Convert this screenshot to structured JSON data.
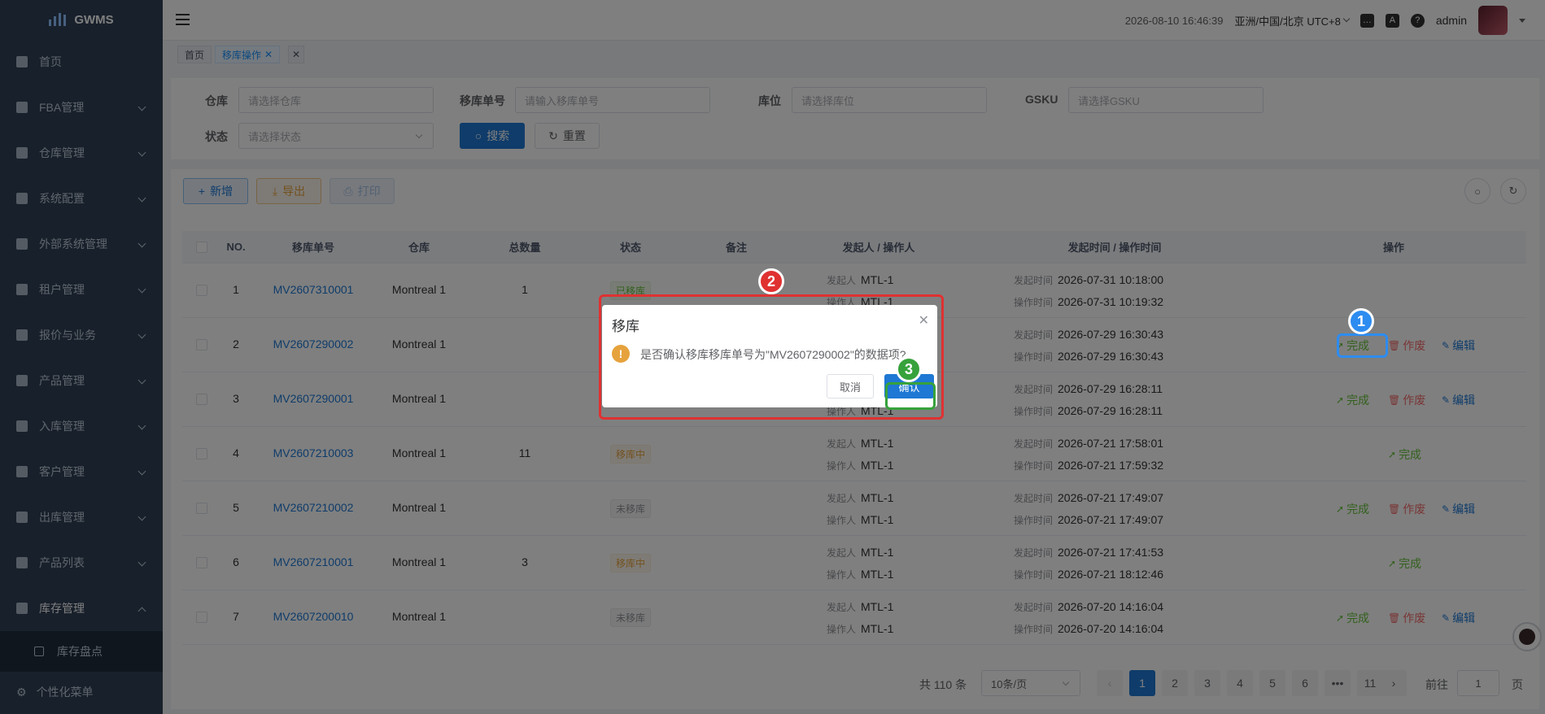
{
  "app": {
    "name": "GWMS"
  },
  "sidebar": {
    "items": [
      {
        "label": "首页",
        "icon": "dashboard-icon",
        "has_children": false
      },
      {
        "label": "FBA管理",
        "icon": "fba-icon",
        "has_children": true
      },
      {
        "label": "仓库管理",
        "icon": "warehouse-icon",
        "has_children": true
      },
      {
        "label": "系统配置",
        "icon": "config-icon",
        "has_children": true
      },
      {
        "label": "外部系统管理",
        "icon": "grid-icon",
        "has_children": true
      },
      {
        "label": "租户管理",
        "icon": "bar-chart-icon",
        "has_children": true
      },
      {
        "label": "报价与业务",
        "icon": "quote-icon",
        "has_children": true
      },
      {
        "label": "产品管理",
        "icon": "cart-icon",
        "has_children": true
      },
      {
        "label": "入库管理",
        "icon": "home-icon",
        "has_children": true
      },
      {
        "label": "客户管理",
        "icon": "user-icon",
        "has_children": true
      },
      {
        "label": "出库管理",
        "icon": "grid-icon",
        "has_children": true
      },
      {
        "label": "产品列表",
        "icon": "book-icon",
        "has_children": true
      },
      {
        "label": "库存管理",
        "icon": "table-icon",
        "has_children": true,
        "open": true
      }
    ],
    "sub_item": "库存盘点",
    "bottom_item": "个性化菜单"
  },
  "header": {
    "datetime": "2026-08-10 16:46:39",
    "timezone": "亚洲/中国/北京 UTC+8",
    "user": "admin"
  },
  "tags": {
    "home": "首页",
    "current": "移库操作"
  },
  "search": {
    "warehouse_label": "仓库",
    "warehouse_placeholder": "请选择仓库",
    "move_no_label": "移库单号",
    "move_no_placeholder": "请输入移库单号",
    "location_label": "库位",
    "location_placeholder": "请选择库位",
    "gsku_label": "GSKU",
    "gsku_placeholder": "请选择GSKU",
    "status_label": "状态",
    "status_placeholder": "请选择状态",
    "search_button": "搜索",
    "reset_button": "重置"
  },
  "toolbar": {
    "add": "新增",
    "export": "导出",
    "print": "打印"
  },
  "table": {
    "headers": [
      "NO.",
      "移库单号",
      "仓库",
      "总数量",
      "状态",
      "备注",
      "发起人 / 操作人",
      "发起时间 / 操作时间",
      "操作"
    ],
    "initiator_key": "发起人",
    "operator_key": "操作人",
    "start_time_key": "发起时间",
    "op_time_key": "操作时间",
    "actions": {
      "complete": "完成",
      "void": "作废",
      "edit": "编辑"
    },
    "rows": [
      {
        "no": "1",
        "move_no": "MV2607310001",
        "warehouse": "Montreal 1",
        "qty": "1",
        "status": "已移库",
        "status_type": "done",
        "initiator": "MTL-1",
        "operator": "MTL-1",
        "start_time": "2026-07-31 10:18:00",
        "op_time": "2026-07-31 10:19:32",
        "show_complete": false,
        "show_void": false,
        "show_edit": false
      },
      {
        "no": "2",
        "move_no": "MV2607290002",
        "warehouse": "Montreal 1",
        "qty": "",
        "status": "",
        "status_type": "",
        "initiator": "",
        "operator": "",
        "start_time": "2026-07-29 16:30:43",
        "op_time": "2026-07-29 16:30:43",
        "show_complete": true,
        "show_void": true,
        "show_edit": true
      },
      {
        "no": "3",
        "move_no": "MV2607290001",
        "warehouse": "Montreal 1",
        "qty": "",
        "status": "",
        "status_type": "",
        "initiator": "",
        "operator": "MTL-1",
        "start_time": "2026-07-29 16:28:11",
        "op_time": "2026-07-29 16:28:11",
        "show_complete": true,
        "show_void": true,
        "show_edit": true
      },
      {
        "no": "4",
        "move_no": "MV2607210003",
        "warehouse": "Montreal 1",
        "qty": "11",
        "status": "移库中",
        "status_type": "ing",
        "initiator": "MTL-1",
        "operator": "MTL-1",
        "start_time": "2026-07-21 17:58:01",
        "op_time": "2026-07-21 17:59:32",
        "show_complete": true,
        "show_void": false,
        "show_edit": false
      },
      {
        "no": "5",
        "move_no": "MV2607210002",
        "warehouse": "Montreal 1",
        "qty": "",
        "status": "未移库",
        "status_type": "not",
        "initiator": "MTL-1",
        "operator": "MTL-1",
        "start_time": "2026-07-21 17:49:07",
        "op_time": "2026-07-21 17:49:07",
        "show_complete": true,
        "show_void": true,
        "show_edit": true
      },
      {
        "no": "6",
        "move_no": "MV2607210001",
        "warehouse": "Montreal 1",
        "qty": "3",
        "status": "移库中",
        "status_type": "ing",
        "initiator": "MTL-1",
        "operator": "MTL-1",
        "start_time": "2026-07-21 17:41:53",
        "op_time": "2026-07-21 18:12:46",
        "show_complete": true,
        "show_void": false,
        "show_edit": false
      },
      {
        "no": "7",
        "move_no": "MV2607200010",
        "warehouse": "Montreal 1",
        "qty": "",
        "status": "未移库",
        "status_type": "not",
        "initiator": "MTL-1",
        "operator": "MTL-1",
        "start_time": "2026-07-20 14:16:04",
        "op_time": "2026-07-20 14:16:04",
        "show_complete": true,
        "show_void": true,
        "show_edit": true
      }
    ]
  },
  "pagination": {
    "total": "共 110 条",
    "page_size": "10条/页",
    "pages": [
      "1",
      "2",
      "3",
      "4",
      "5",
      "6",
      "•••",
      "11"
    ],
    "current": "1",
    "goto_label": "前往",
    "goto_value": "1",
    "goto_suffix": "页"
  },
  "dialog": {
    "title": "移库",
    "message": "是否确认移库移库单号为\"MV2607290002\"的数据项?",
    "cancel": "取消",
    "confirm": "确认"
  },
  "annotations": [
    {
      "label": "1",
      "color": "#2d8cf0"
    },
    {
      "label": "2",
      "color": "#e03131"
    },
    {
      "label": "3",
      "color": "#37a23b"
    }
  ],
  "colors": {
    "primary": "#1e78d4",
    "sidebar": "#304156",
    "success": "#67c23a",
    "danger": "#f56c6c",
    "warning": "#e6a23c"
  }
}
